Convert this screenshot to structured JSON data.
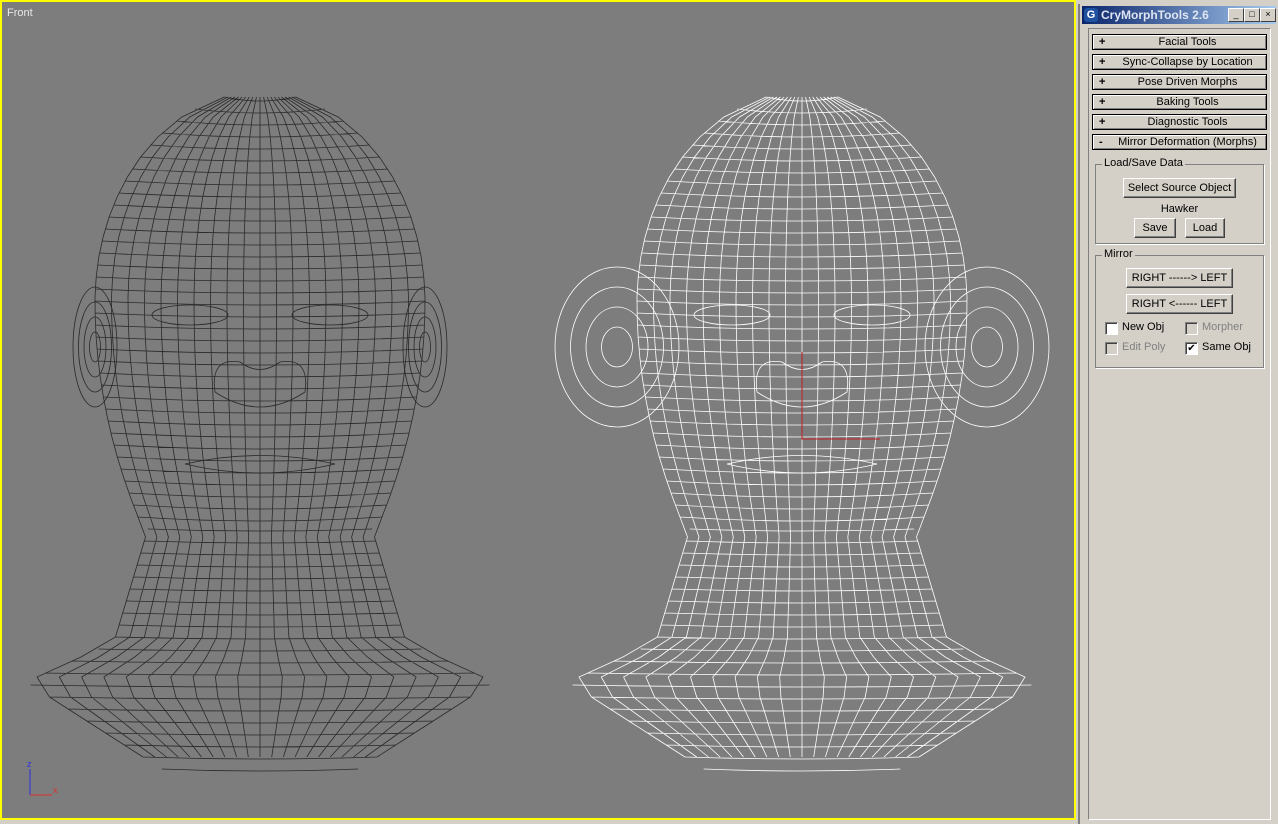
{
  "viewport": {
    "label": "Front",
    "axis_z": "z",
    "axis_x": "x"
  },
  "window": {
    "title": "CryMorphTools 2.6",
    "controls": {
      "minimize": "_",
      "maximize": "□",
      "close": "×"
    }
  },
  "rollouts": [
    {
      "sign": "+",
      "label": "Facial Tools"
    },
    {
      "sign": "+",
      "label": "Sync-Collapse by Location"
    },
    {
      "sign": "+",
      "label": "Pose Driven Morphs"
    },
    {
      "sign": "+",
      "label": "Baking Tools"
    },
    {
      "sign": "+",
      "label": "Diagnostic Tools"
    },
    {
      "sign": "-",
      "label": "Mirror Deformation (Morphs)"
    }
  ],
  "load_save": {
    "title": "Load/Save Data",
    "select_source": "Select Source Object",
    "object_name": "Hawker",
    "save": "Save",
    "load": "Load"
  },
  "mirror": {
    "title": "Mirror",
    "right_to_left": "RIGHT ------> LEFT",
    "left_to_right": "RIGHT <------ LEFT",
    "new_obj": {
      "label": "New Obj",
      "checked": false,
      "enabled": true
    },
    "morpher": {
      "label": "Morpher",
      "checked": false,
      "enabled": false
    },
    "edit_poly": {
      "label": "Edit Poly",
      "checked": false,
      "enabled": false
    },
    "same_obj": {
      "label": "Same Obj",
      "checked": true,
      "enabled": true
    }
  },
  "colors": {
    "viewport_bg": "#7d7d7d",
    "active_border": "#ffff00",
    "mesh_dark": "#2a2a2a",
    "mesh_selected": "#ffffff"
  }
}
